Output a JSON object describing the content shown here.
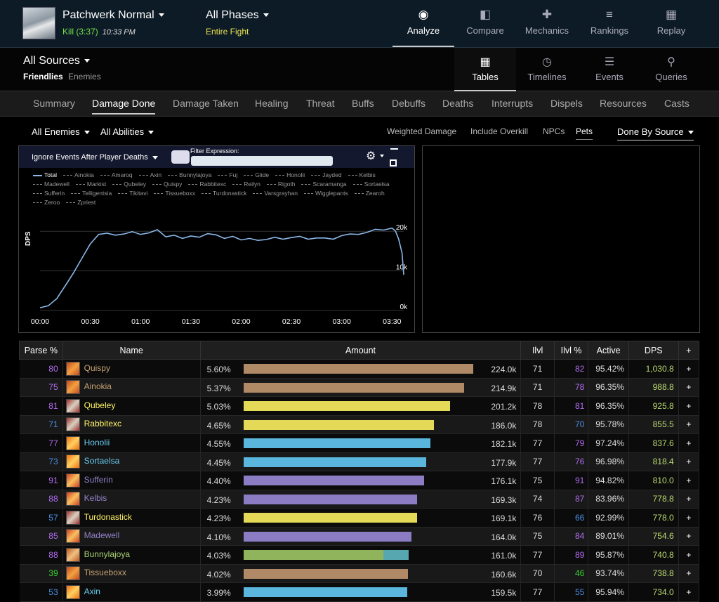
{
  "header": {
    "boss_title": "Patchwerk Normal",
    "kill_label": "Kill (3:37)",
    "kill_time": "10:33 PM",
    "phase_title": "All Phases",
    "phase_sub": "Entire Fight"
  },
  "nav": [
    {
      "label": "Analyze",
      "icon": "eye-icon",
      "glyph": "◉"
    },
    {
      "label": "Compare",
      "icon": "compare-icon",
      "glyph": "◧"
    },
    {
      "label": "Mechanics",
      "icon": "puzzle-icon",
      "glyph": "✚"
    },
    {
      "label": "Rankings",
      "icon": "rankings-icon",
      "glyph": "≡"
    },
    {
      "label": "Replay",
      "icon": "film-icon",
      "glyph": "▦"
    }
  ],
  "sources": {
    "title": "All Sources",
    "friendlies": "Friendlies",
    "enemies": "Enemies"
  },
  "views": [
    {
      "label": "Tables",
      "icon": "table-icon",
      "glyph": "▦"
    },
    {
      "label": "Timelines",
      "icon": "clock-icon",
      "glyph": "◷"
    },
    {
      "label": "Events",
      "icon": "list-icon",
      "glyph": "☰"
    },
    {
      "label": "Queries",
      "icon": "pin-icon",
      "glyph": "⚲"
    }
  ],
  "tabs": [
    "Summary",
    "Damage Done",
    "Damage Taken",
    "Healing",
    "Threat",
    "Buffs",
    "Debuffs",
    "Deaths",
    "Interrupts",
    "Dispels",
    "Resources",
    "Casts"
  ],
  "filters": {
    "enemies": "All Enemies",
    "abilities": "All Abilities",
    "weighted": "Weighted Damage",
    "overkill": "Include Overkill",
    "npcs": "NPCs",
    "pets": "Pets",
    "done_by": "Done By Source"
  },
  "chart_panel": {
    "ignore_label": "Ignore Events After Player Deaths",
    "filter_label": "Filter Expression:"
  },
  "chart_data": {
    "type": "line",
    "series": [
      {
        "name": "Total",
        "color": "#8ab8ea",
        "values": [
          [
            0,
            700
          ],
          [
            5,
            1200
          ],
          [
            10,
            3000
          ],
          [
            15,
            6200
          ],
          [
            20,
            9500
          ],
          [
            25,
            13200
          ],
          [
            30,
            16800
          ],
          [
            35,
            19200
          ],
          [
            40,
            19500
          ],
          [
            45,
            19000
          ],
          [
            50,
            19300
          ],
          [
            55,
            19900
          ],
          [
            60,
            19200
          ],
          [
            65,
            19600
          ],
          [
            70,
            20400
          ],
          [
            75,
            18600
          ],
          [
            80,
            19000
          ],
          [
            85,
            18200
          ],
          [
            90,
            18800
          ],
          [
            95,
            18500
          ],
          [
            100,
            19400
          ],
          [
            105,
            19100
          ],
          [
            110,
            18200
          ],
          [
            115,
            18700
          ],
          [
            120,
            17800
          ],
          [
            125,
            18200
          ],
          [
            130,
            17700
          ],
          [
            135,
            17900
          ],
          [
            140,
            18500
          ],
          [
            145,
            18000
          ],
          [
            150,
            18400
          ],
          [
            155,
            18700
          ],
          [
            160,
            18000
          ],
          [
            165,
            18300
          ],
          [
            170,
            18300
          ],
          [
            175,
            18000
          ],
          [
            180,
            18900
          ],
          [
            185,
            19300
          ],
          [
            190,
            19200
          ],
          [
            195,
            19700
          ],
          [
            200,
            20500
          ],
          [
            205,
            20300
          ],
          [
            210,
            20800
          ],
          [
            212,
            20100
          ],
          [
            214,
            18000
          ],
          [
            216,
            14500
          ],
          [
            217,
            9000
          ]
        ]
      }
    ],
    "legend": [
      "Total",
      "Ainokia",
      "Amaroq",
      "Axin",
      "Bunnylajoya",
      "Fuj",
      "Glide",
      "Honolii",
      "Jayded",
      "Kelbis",
      "Madewell",
      "Markist",
      "Qubeley",
      "Quispy",
      "Rabbitexc",
      "Reilyn",
      "Rigoth",
      "Scaramanga",
      "Sortaelsa",
      "Sufferin",
      "Telligentsia",
      "Tikitavi",
      "Tissueboxx",
      "Turdonastick",
      "Varsgrayhan",
      "Wigglepants",
      "Zearoh",
      "Zeroo",
      "Zpriest"
    ],
    "xlim": [
      0,
      217
    ],
    "ylim": [
      0,
      25000
    ],
    "x_ticks": [
      {
        "v": 0,
        "l": "00:00"
      },
      {
        "v": 30,
        "l": "00:30"
      },
      {
        "v": 60,
        "l": "01:00"
      },
      {
        "v": 90,
        "l": "01:30"
      },
      {
        "v": 120,
        "l": "02:00"
      },
      {
        "v": 150,
        "l": "02:30"
      },
      {
        "v": 180,
        "l": "03:00"
      },
      {
        "v": 210,
        "l": "03:30"
      }
    ],
    "y_ticks": [
      {
        "v": 0,
        "l": "0k"
      },
      {
        "v": 10000,
        "l": "10k"
      },
      {
        "v": 20000,
        "l": "20k"
      }
    ],
    "ylabel": "DPS",
    "grid": true
  },
  "table": {
    "headers": [
      "Parse %",
      "Name",
      "Amount",
      "Ilvl",
      "Ilvl %",
      "Active",
      "DPS",
      "+"
    ],
    "rows": [
      {
        "parse": "80",
        "parse_color": "#b06cf0",
        "name": "Quispy",
        "name_color": "#c4a070",
        "pct": "5.60%",
        "fill": 1.0,
        "bar_color": "#b08966",
        "bar2": 0,
        "amount": "224.0k",
        "ilvl": "71",
        "ilvl_pct": "82",
        "ilvl_color": "#b06cf0",
        "active": "95.42%",
        "dps": "1,030.8",
        "icon": "warrior-icon",
        "icon_colors": [
          "#c14a20",
          "#f3a040"
        ]
      },
      {
        "parse": "75",
        "parse_color": "#b06cf0",
        "name": "Ainokia",
        "name_color": "#c4a070",
        "pct": "5.37%",
        "fill": 0.96,
        "bar_color": "#b08966",
        "bar2": 0,
        "amount": "214.9k",
        "ilvl": "71",
        "ilvl_pct": "78",
        "ilvl_color": "#b06cf0",
        "active": "96.35%",
        "dps": "988.8",
        "icon": "warrior-icon",
        "icon_colors": [
          "#c14a20",
          "#f3a040"
        ]
      },
      {
        "parse": "81",
        "parse_color": "#b06cf0",
        "name": "Qubeley",
        "name_color": "#fff468",
        "pct": "5.03%",
        "fill": 0.898,
        "bar_color": "#e4da58",
        "bar2": 0,
        "amount": "201.2k",
        "ilvl": "78",
        "ilvl_pct": "81",
        "ilvl_color": "#b06cf0",
        "active": "96.35%",
        "dps": "925.8",
        "icon": "rogue-icon",
        "icon_colors": [
          "#a03030",
          "#d8d0c0"
        ]
      },
      {
        "parse": "71",
        "parse_color": "#4a8de0",
        "name": "Rabbitexc",
        "name_color": "#fff468",
        "pct": "4.65%",
        "fill": 0.83,
        "bar_color": "#e4da58",
        "bar2": 0,
        "amount": "186.0k",
        "ilvl": "78",
        "ilvl_pct": "70",
        "ilvl_color": "#4a8de0",
        "active": "95.78%",
        "dps": "855.5",
        "icon": "rogue-icon",
        "icon_colors": [
          "#a03030",
          "#d8d0c0"
        ]
      },
      {
        "parse": "77",
        "parse_color": "#b06cf0",
        "name": "Honolii",
        "name_color": "#68ccef",
        "pct": "4.55%",
        "fill": 0.813,
        "bar_color": "#5ab6dc",
        "bar2": 0,
        "amount": "182.1k",
        "ilvl": "77",
        "ilvl_pct": "79",
        "ilvl_color": "#b06cf0",
        "active": "97.24%",
        "dps": "837.6",
        "icon": "mage-icon",
        "icon_colors": [
          "#f07010",
          "#ffd060"
        ]
      },
      {
        "parse": "73",
        "parse_color": "#4a8de0",
        "name": "Sortaelsa",
        "name_color": "#68ccef",
        "pct": "4.45%",
        "fill": 0.795,
        "bar_color": "#5ab6dc",
        "bar2": 0,
        "amount": "177.9k",
        "ilvl": "77",
        "ilvl_pct": "76",
        "ilvl_color": "#b06cf0",
        "active": "96.98%",
        "dps": "818.4",
        "icon": "mage-icon",
        "icon_colors": [
          "#f07010",
          "#ffd060"
        ]
      },
      {
        "parse": "91",
        "parse_color": "#b06cf0",
        "name": "Sufferin",
        "name_color": "#9482c9",
        "pct": "4.40%",
        "fill": 0.787,
        "bar_color": "#8b7cc4",
        "bar2": 0,
        "amount": "176.1k",
        "ilvl": "75",
        "ilvl_pct": "91",
        "ilvl_color": "#b06cf0",
        "active": "94.82%",
        "dps": "810.0",
        "icon": "warlock-icon",
        "icon_colors": [
          "#d04020",
          "#f8c060"
        ]
      },
      {
        "parse": "88",
        "parse_color": "#b06cf0",
        "name": "Kelbis",
        "name_color": "#9482c9",
        "pct": "4.23%",
        "fill": 0.756,
        "bar_color": "#8b7cc4",
        "bar2": 0,
        "amount": "169.3k",
        "ilvl": "74",
        "ilvl_pct": "87",
        "ilvl_color": "#b06cf0",
        "active": "83.96%",
        "dps": "778.8",
        "icon": "warlock-icon",
        "icon_colors": [
          "#d04020",
          "#f8c060"
        ]
      },
      {
        "parse": "57",
        "parse_color": "#4a8de0",
        "name": "Turdonastick",
        "name_color": "#fff468",
        "pct": "4.23%",
        "fill": 0.756,
        "bar_color": "#e4da58",
        "bar2": 0,
        "amount": "169.1k",
        "ilvl": "76",
        "ilvl_pct": "66",
        "ilvl_color": "#4a8de0",
        "active": "92.99%",
        "dps": "778.0",
        "icon": "rogue-icon",
        "icon_colors": [
          "#a03030",
          "#d8d0c0"
        ]
      },
      {
        "parse": "85",
        "parse_color": "#b06cf0",
        "name": "Madewell",
        "name_color": "#9482c9",
        "pct": "4.10%",
        "fill": 0.732,
        "bar_color": "#8b7cc4",
        "bar2": 0,
        "amount": "164.0k",
        "ilvl": "75",
        "ilvl_pct": "84",
        "ilvl_color": "#b06cf0",
        "active": "89.01%",
        "dps": "754.6",
        "icon": "warlock-icon",
        "icon_colors": [
          "#d04020",
          "#f8c060"
        ]
      },
      {
        "parse": "88",
        "parse_color": "#b06cf0",
        "name": "Bunnylajoya",
        "name_color": "#aad372",
        "pct": "4.03%",
        "fill": 0.61,
        "bar_color": "#8fb45c",
        "bar2": 0.11,
        "amount": "161.0k",
        "ilvl": "77",
        "ilvl_pct": "89",
        "ilvl_color": "#b06cf0",
        "active": "95.87%",
        "dps": "740.8",
        "icon": "hunter-icon",
        "icon_colors": [
          "#c05a20",
          "#f0c080"
        ]
      },
      {
        "parse": "39",
        "parse_color": "#38d030",
        "name": "Tissueboxx",
        "name_color": "#c4a070",
        "pct": "4.02%",
        "fill": 0.717,
        "bar_color": "#b08966",
        "bar2": 0,
        "amount": "160.6k",
        "ilvl": "70",
        "ilvl_pct": "46",
        "ilvl_color": "#38d030",
        "active": "93.74%",
        "dps": "738.8",
        "icon": "warrior-icon",
        "icon_colors": [
          "#c14a20",
          "#f3a040"
        ]
      },
      {
        "parse": "53",
        "parse_color": "#4a8de0",
        "name": "Axin",
        "name_color": "#68ccef",
        "pct": "3.99%",
        "fill": 0.713,
        "bar_color": "#5ab6dc",
        "bar2": 0,
        "amount": "159.5k",
        "ilvl": "77",
        "ilvl_pct": "55",
        "ilvl_color": "#4a8de0",
        "active": "95.94%",
        "dps": "734.0",
        "icon": "mage-icon",
        "icon_colors": [
          "#f07010",
          "#ffd060"
        ]
      }
    ]
  }
}
